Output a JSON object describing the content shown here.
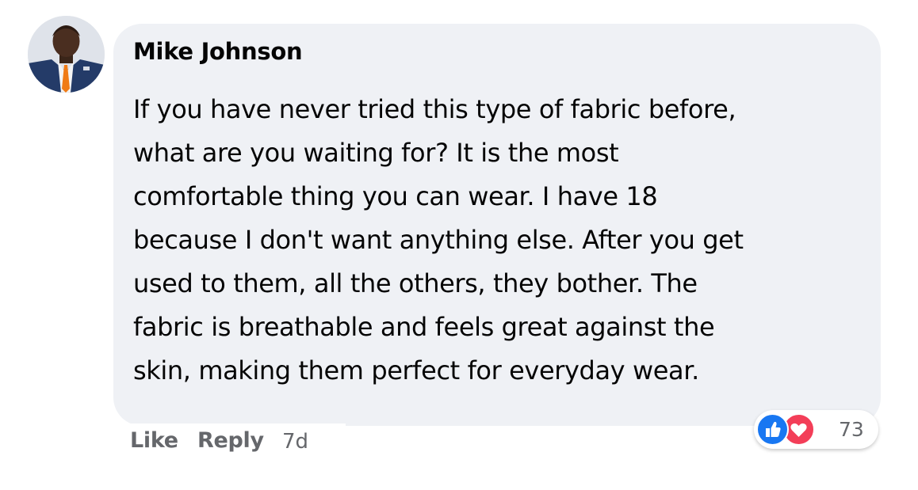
{
  "comment": {
    "author": "Mike Johnson",
    "text": "If you have never tried this type of fabric before,\nwhat are you waiting for? It is the most\ncomfortable thing you can wear. I have 18\nbecause I don't want anything else. After you get\nused to them, all the others, they bother. The\nfabric is breathable and feels great against the\nskin, making them perfect for everyday wear.",
    "avatar_icon": "profile-photo"
  },
  "actions": {
    "like_label": "Like",
    "reply_label": "Reply",
    "timestamp": "7d"
  },
  "reactions": {
    "icons": [
      "thumbs-up-icon",
      "heart-icon"
    ],
    "count": "73"
  },
  "colors": {
    "bubble_bg": "#eff1f5",
    "secondary_text": "#65676b",
    "like_blue": "#1877f2",
    "love_red": "#f33e58"
  }
}
